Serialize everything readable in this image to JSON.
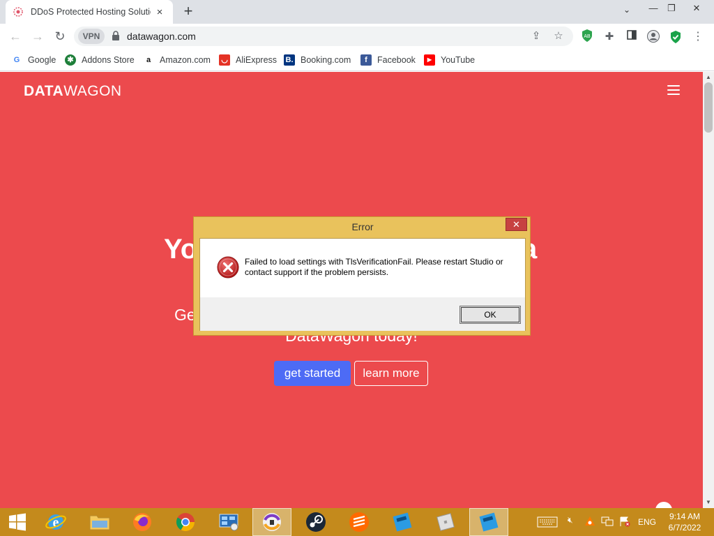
{
  "tab": {
    "title": "DDoS Protected Hosting Solutions",
    "close": "×"
  },
  "newtab": "+",
  "window": {
    "minimize": "—",
    "restore": "❐",
    "close": "✕"
  },
  "toolbar": {
    "vpn": "VPN",
    "url": "datawagon.com"
  },
  "bookmarks": [
    {
      "label": "Google",
      "icon": "google-icon",
      "color": "#4285f4"
    },
    {
      "label": "Addons Store",
      "icon": "addons-store-icon",
      "color": "#1e7f3a"
    },
    {
      "label": "Amazon.com",
      "icon": "amazon-icon",
      "color": "#111111"
    },
    {
      "label": "AliExpress",
      "icon": "aliexpress-icon",
      "color": "#e43225"
    },
    {
      "label": "Booking.com",
      "icon": "booking-icon",
      "color": "#003580"
    },
    {
      "label": "Facebook",
      "icon": "facebook-icon",
      "color": "#3b5998"
    },
    {
      "label": "YouTube",
      "icon": "youtube-icon",
      "color": "#ff0000"
    }
  ],
  "page": {
    "logo_bold": "DATA",
    "logo_light": "WAGON",
    "hero_title_left": "Yo",
    "hero_title_right": "a",
    "hero_sub_left": "Ge",
    "hero_sub_bottom": "DataWagon today!",
    "btn_start": "get started",
    "btn_learn": "learn more",
    "bg_color": "#ec4a4d"
  },
  "dialog": {
    "title": "Error",
    "close": "✕",
    "message": "Failed to load settings with TlsVerificationFail. Please restart Studio or contact support if the problem persists.",
    "ok": "OK"
  },
  "taskbar": {
    "lang": "ENG",
    "time": "9:14 AM",
    "date": "6/7/2022",
    "color": "#c48a1c"
  }
}
